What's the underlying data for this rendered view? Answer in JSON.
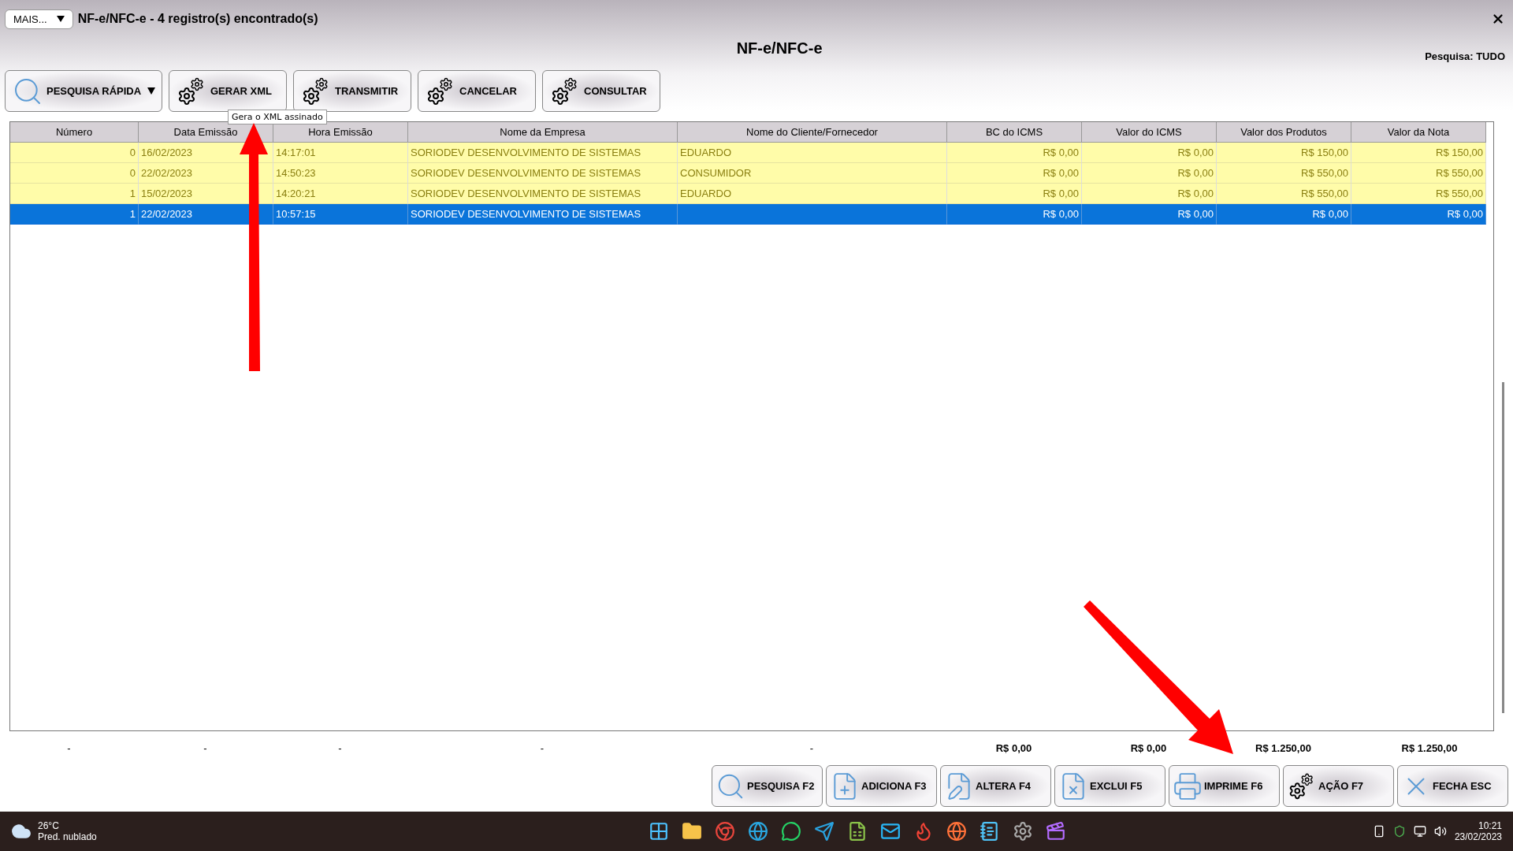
{
  "window": {
    "menu_button": "MAIS...",
    "title": "NF-e/NFC-e - 4 registro(s) encontrado(s)"
  },
  "header": {
    "title": "NF-e/NFC-e",
    "search_scope": "Pesquisa: TUDO"
  },
  "toolbar": [
    {
      "label": "PESQUISA RÁPIDA",
      "kind": "search",
      "dropdown": true
    },
    {
      "label": "GERAR XML",
      "kind": "gears",
      "dropdown": false
    },
    {
      "label": "TRANSMITIR",
      "kind": "gears",
      "dropdown": false
    },
    {
      "label": "CANCELAR",
      "kind": "gears",
      "dropdown": false
    },
    {
      "label": "CONSULTAR",
      "kind": "gears",
      "dropdown": false
    }
  ],
  "tooltip": "Gera o XML assinado",
  "table": {
    "columns": [
      "Número",
      "Data Emissão",
      "Hora Emissão",
      "Nome da Empresa",
      "Nome do Cliente/Fornecedor",
      "BC do ICMS",
      "Valor do ICMS",
      "Valor dos Produtos",
      "Valor da Nota"
    ],
    "rows": [
      {
        "selected": false,
        "cells": [
          "0",
          "16/02/2023",
          "14:17:01",
          "SORIODEV DESENVOLVIMENTO DE SISTEMAS",
          "EDUARDO",
          "R$ 0,00",
          "R$ 0,00",
          "R$ 150,00",
          "R$ 150,00"
        ]
      },
      {
        "selected": false,
        "cells": [
          "0",
          "22/02/2023",
          "14:50:23",
          "SORIODEV DESENVOLVIMENTO DE SISTEMAS",
          "CONSUMIDOR",
          "R$ 0,00",
          "R$ 0,00",
          "R$ 550,00",
          "R$ 550,00"
        ]
      },
      {
        "selected": false,
        "cells": [
          "1",
          "15/02/2023",
          "14:20:21",
          "SORIODEV DESENVOLVIMENTO DE SISTEMAS",
          "EDUARDO",
          "R$ 0,00",
          "R$ 0,00",
          "R$ 550,00",
          "R$ 550,00"
        ]
      },
      {
        "selected": true,
        "cells": [
          "1",
          "22/02/2023",
          "10:57:15",
          "SORIODEV DESENVOLVIMENTO DE SISTEMAS",
          "",
          "R$ 0,00",
          "R$ 0,00",
          "R$ 0,00",
          "R$ 0,00"
        ]
      }
    ]
  },
  "totals": [
    "-",
    "-",
    "-",
    "-",
    "-",
    "R$ 0,00",
    "R$ 0,00",
    "R$ 1.250,00",
    "R$ 1.250,00"
  ],
  "actions": [
    {
      "label": "PESQUISA F2",
      "kind": "search"
    },
    {
      "label": "ADICIONA F3",
      "kind": "add"
    },
    {
      "label": "ALTERA F4",
      "kind": "edit"
    },
    {
      "label": "EXCLUI F5",
      "kind": "delete"
    },
    {
      "label": "IMPRIME F6",
      "kind": "print"
    },
    {
      "label": "AÇÃO F7",
      "kind": "gears"
    },
    {
      "label": "FECHA ESC",
      "kind": "close"
    }
  ],
  "taskbar": {
    "temperature": "26°C",
    "weather": "Pred. nublado",
    "time": "10:21",
    "date": "23/02/2023"
  }
}
